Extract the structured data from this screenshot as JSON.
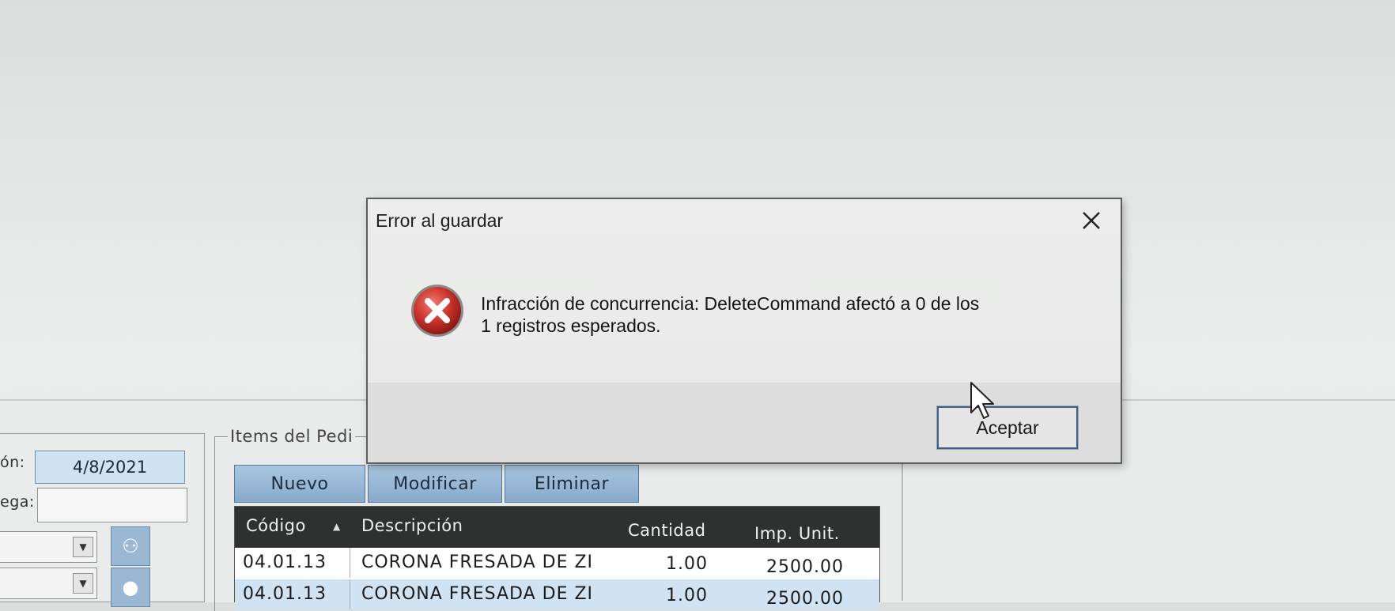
{
  "background_form": {
    "labels": {
      "fecha": "ón:",
      "entrega": "ega:"
    },
    "date_value": "4/8/2021",
    "group_title": "Items del Pedi",
    "toolbar": {
      "new_label": "Nuevo",
      "modify_label": "Modificar",
      "delete_label": "Eliminar"
    },
    "grid": {
      "columns": [
        "Código",
        "Descripción",
        "Cantidad",
        "Imp. Unit."
      ],
      "rows": [
        {
          "codigo": "04.01.13",
          "descripcion": "CORONA FRESADA DE ZI",
          "cantidad": "1.00",
          "imp_unit": "2500.00"
        },
        {
          "codigo": "04.01.13",
          "descripcion": "CORONA FRESADA DE ZI",
          "cantidad": "1.00",
          "imp_unit": "2500.00"
        }
      ]
    }
  },
  "dialog": {
    "title": "Error al guardar",
    "icon": "error-icon",
    "message_line1": "Infracción de concurrencia: DeleteCommand afectó a 0 de los",
    "message_line2": "1 registros esperados.",
    "ok_label": "Aceptar"
  },
  "colors": {
    "grid_header": "#2e3130",
    "selected_row": "#cfe3f3",
    "toolbar_button": "#9bbbd8",
    "error_red": "#c8322a"
  }
}
